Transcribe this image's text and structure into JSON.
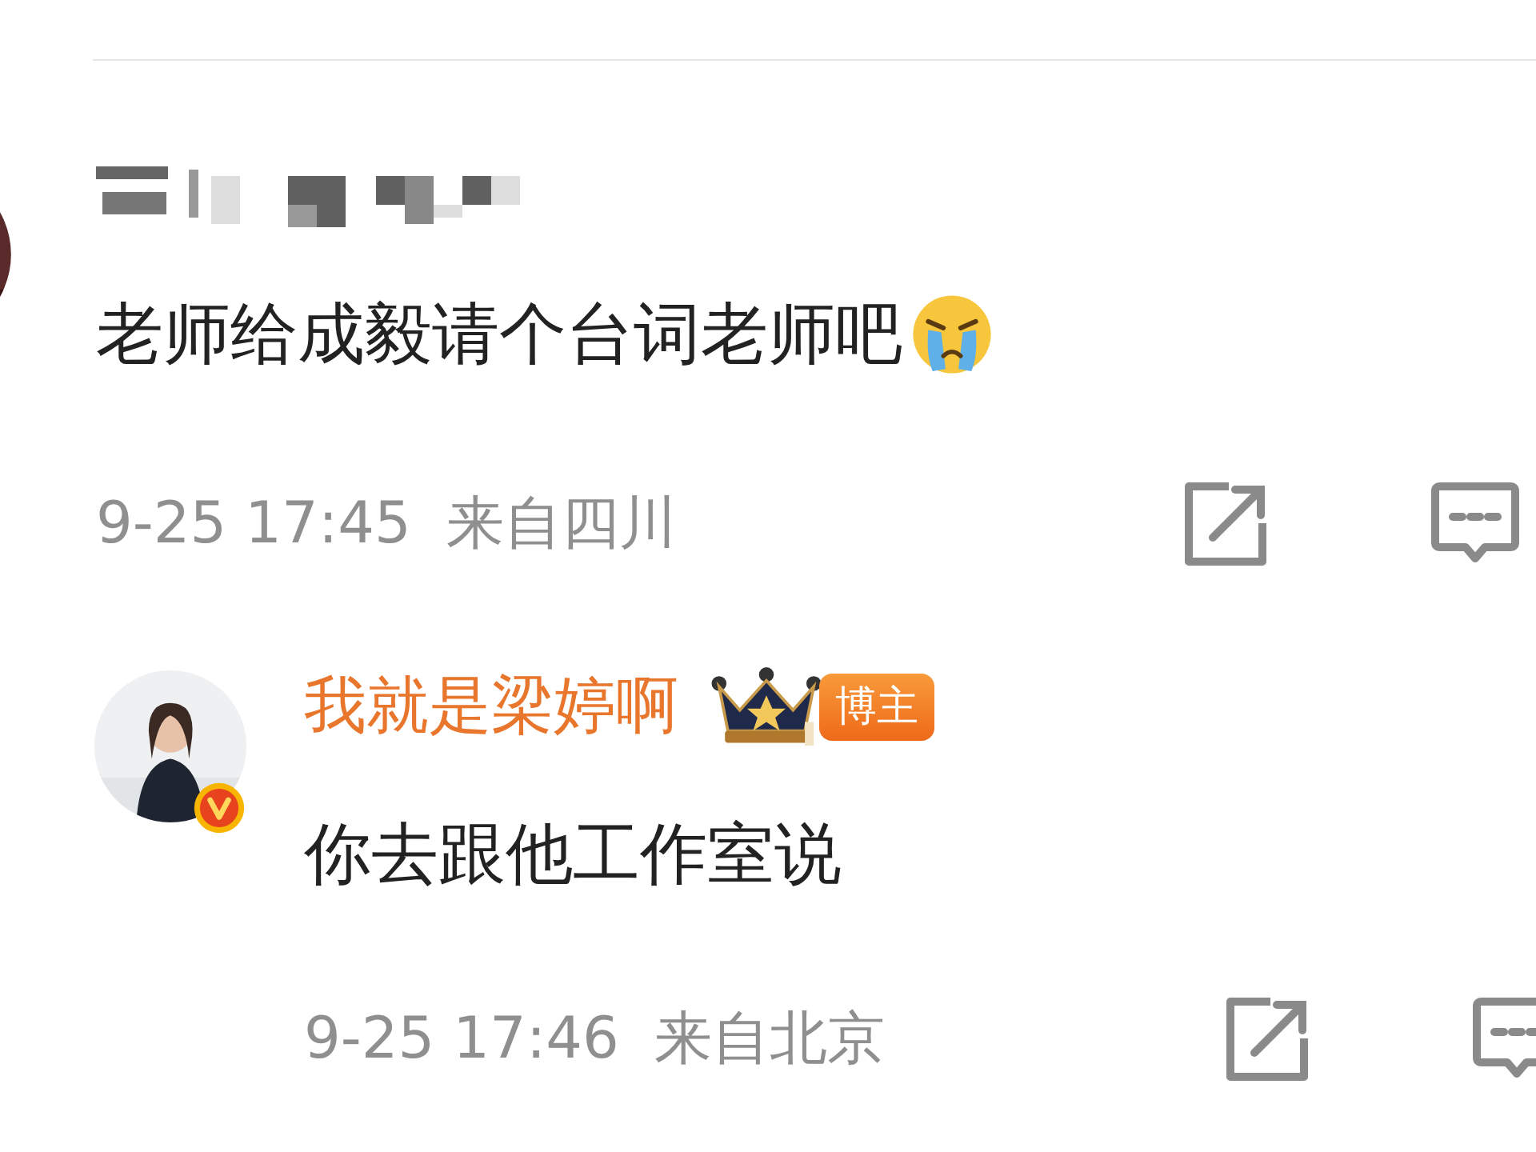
{
  "comments": [
    {
      "kind": "redacted",
      "text": "老师给成毅请个台词老师吧",
      "emoji": true,
      "time": "9-25 17:45",
      "location": "来自四川",
      "verified": false
    },
    {
      "kind": "blogger",
      "emoji": false,
      "author": "我就是梁婷啊",
      "badge": "博主",
      "text": "你去跟他工作室说",
      "time": "9-25 17:46",
      "location": "来自北京",
      "verified": true
    }
  ]
}
